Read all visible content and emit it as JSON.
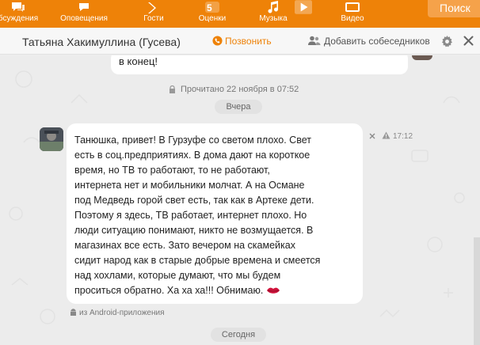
{
  "nav": {
    "items": [
      {
        "label": "бсуждения",
        "icon": "discussions-icon"
      },
      {
        "label": "Оповещения",
        "icon": "notifications-icon"
      },
      {
        "label": "Гости",
        "icon": "guests-icon"
      },
      {
        "label": "Оценки",
        "icon": "ratings-icon",
        "badge": "5"
      },
      {
        "label": "Музыка",
        "icon": "music-icon"
      },
      {
        "label": "Видео",
        "icon": "video-icon"
      }
    ],
    "search_label": "Поиск",
    "accent": "#ee8208"
  },
  "header": {
    "title": "Татьяна Хакимуллина (Гусева)",
    "call_label": "Позвонить",
    "add_label": "Добавить собеседников"
  },
  "messages": {
    "prev_text": "в конец!",
    "read_status": "Прочитано 22 ноября в 07:52",
    "date_yesterday": "Вчера",
    "message": {
      "text": "Танюшка, привет! В Гурзуфе со светом плохо. Свет\nесть в соц.предприятиях. В дома дают на короткое\nвремя, но ТВ  то работают, то не работают,\nинтернета нет и мобильники молчат.  А на Османе\nпод Медведь горой свет есть, так как в Артеке дети.\nПоэтому я здесь, ТВ работает, интернет плохо.  Но\nлюди ситуацию понимают,  никто не возмущается. В\nмагазинах все есть. Зато вечером на скамейках\nсидит народ как в старые добрые времена и смеется\nнад хохлами, которые думают, что мы будем\nпроситься обратно. Ха ха ха!!!  Обнимаю.",
      "time": "17:12",
      "via": "из Android-приложения"
    },
    "date_today": "Сегодня"
  }
}
